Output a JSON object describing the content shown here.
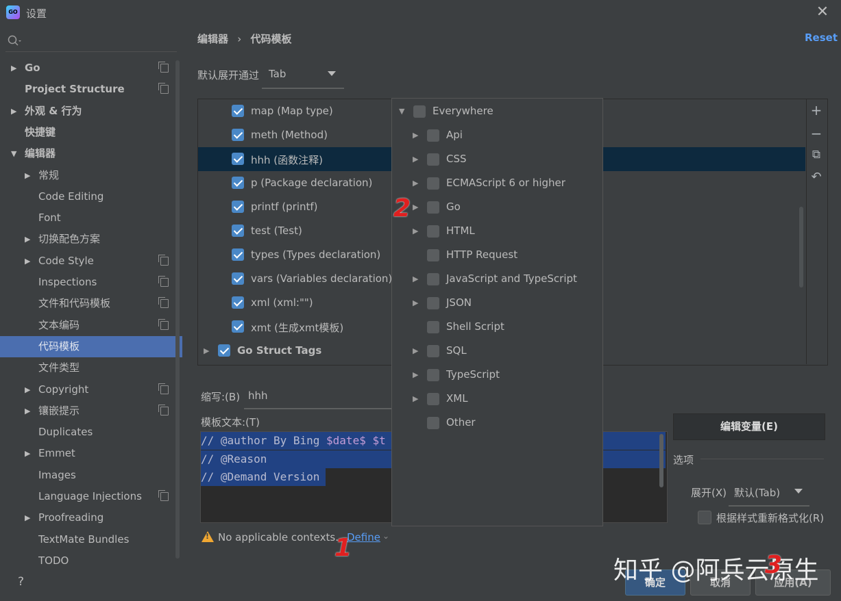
{
  "window": {
    "title": "设置",
    "logo_text": "GO"
  },
  "sidebar": {
    "items": [
      {
        "label": "Go",
        "indent": 0,
        "arrow": "right",
        "bold": true,
        "copy": true
      },
      {
        "label": "Project Structure",
        "indent": 0,
        "arrow": null,
        "bold": true,
        "copy": true
      },
      {
        "label": "外观 & 行为",
        "indent": 0,
        "arrow": "right",
        "bold": true,
        "copy": false
      },
      {
        "label": "快捷键",
        "indent": 0,
        "arrow": null,
        "bold": true,
        "copy": false
      },
      {
        "label": "编辑器",
        "indent": 0,
        "arrow": "down",
        "bold": true,
        "copy": false
      },
      {
        "label": "常规",
        "indent": 1,
        "arrow": "right",
        "bold": false,
        "copy": false
      },
      {
        "label": "Code Editing",
        "indent": 2,
        "arrow": null,
        "bold": false,
        "copy": false
      },
      {
        "label": "Font",
        "indent": 2,
        "arrow": null,
        "bold": false,
        "copy": false
      },
      {
        "label": "切换配色方案",
        "indent": 1,
        "arrow": "right",
        "bold": false,
        "copy": false
      },
      {
        "label": "Code Style",
        "indent": 1,
        "arrow": "right",
        "bold": false,
        "copy": true
      },
      {
        "label": "Inspections",
        "indent": 2,
        "arrow": null,
        "bold": false,
        "copy": true
      },
      {
        "label": "文件和代码模板",
        "indent": 2,
        "arrow": null,
        "bold": false,
        "copy": true
      },
      {
        "label": "文本编码",
        "indent": 2,
        "arrow": null,
        "bold": false,
        "copy": true
      },
      {
        "label": "代码模板",
        "indent": 2,
        "arrow": null,
        "bold": false,
        "copy": false,
        "selected": true
      },
      {
        "label": "文件类型",
        "indent": 2,
        "arrow": null,
        "bold": false,
        "copy": false
      },
      {
        "label": "Copyright",
        "indent": 1,
        "arrow": "right",
        "bold": false,
        "copy": true
      },
      {
        "label": "镶嵌提示",
        "indent": 1,
        "arrow": "right",
        "bold": false,
        "copy": true
      },
      {
        "label": "Duplicates",
        "indent": 2,
        "arrow": null,
        "bold": false,
        "copy": false
      },
      {
        "label": "Emmet",
        "indent": 1,
        "arrow": "right",
        "bold": false,
        "copy": false
      },
      {
        "label": "Images",
        "indent": 2,
        "arrow": null,
        "bold": false,
        "copy": false
      },
      {
        "label": "Language Injections",
        "indent": 2,
        "arrow": null,
        "bold": false,
        "copy": true
      },
      {
        "label": "Proofreading",
        "indent": 1,
        "arrow": "right",
        "bold": false,
        "copy": false
      },
      {
        "label": "TextMate Bundles",
        "indent": 2,
        "arrow": null,
        "bold": false,
        "copy": false
      },
      {
        "label": "TODO",
        "indent": 2,
        "arrow": null,
        "bold": false,
        "copy": false
      }
    ]
  },
  "header": {
    "breadcrumb_parent": "编辑器",
    "breadcrumb_sep": "›",
    "breadcrumb_current": "代码模板",
    "reset": "Reset"
  },
  "expand_by": {
    "label": "默认展开通过",
    "value": "Tab"
  },
  "templates": [
    {
      "text": "map (Map type)"
    },
    {
      "text": "meth (Method)"
    },
    {
      "text": "hhh (函数注释)",
      "selected": true
    },
    {
      "text": "p (Package declaration)"
    },
    {
      "text": "printf (printf)"
    },
    {
      "text": "test (Test)"
    },
    {
      "text": "types (Types declaration)"
    },
    {
      "text": "vars (Variables declaration)"
    },
    {
      "text": "xml (xml:\"\")"
    },
    {
      "text": "xmt (生成xmt模板)"
    },
    {
      "text": "Go Struct Tags",
      "group": true
    }
  ],
  "toolbar": {
    "add": "+",
    "remove": "−",
    "copy": "⧉",
    "revert": "↶"
  },
  "abbreviation": {
    "label": "缩写:(B)",
    "value": "hhh"
  },
  "template_text": {
    "label": "模板文本:(T)",
    "lines": [
      [
        {
          "t": "// @author By Bing ",
          "c": "#b9bcd1"
        },
        {
          "t": "$date$ $t",
          "c": "#c49cd6"
        }
      ],
      [
        {
          "t": "// @Reason",
          "c": "#b9bcd1"
        }
      ],
      [
        {
          "t": "// @Demand Version",
          "c": "#b9bcd1"
        }
      ]
    ]
  },
  "edit_vars": "编辑变量(E)",
  "options": {
    "label": "选项",
    "expand_label": "展开(X)",
    "expand_value": "默认(Tab)",
    "reformat_label": "根据样式重新格式化(R)"
  },
  "warning": {
    "text": "No applicable contexts.",
    "define": "Define",
    "chevron": "⌄"
  },
  "contexts": [
    {
      "label": "Everywhere",
      "level": 0,
      "arrow": "down"
    },
    {
      "label": "Api",
      "level": 1,
      "arrow": "right"
    },
    {
      "label": "CSS",
      "level": 1,
      "arrow": "right"
    },
    {
      "label": "ECMAScript 6 or higher",
      "level": 1,
      "arrow": "right"
    },
    {
      "label": "Go",
      "level": 1,
      "arrow": "right"
    },
    {
      "label": "HTML",
      "level": 1,
      "arrow": "right"
    },
    {
      "label": "HTTP Request",
      "level": 1,
      "arrow": null
    },
    {
      "label": "JavaScript and TypeScript",
      "level": 1,
      "arrow": "right"
    },
    {
      "label": "JSON",
      "level": 1,
      "arrow": "right"
    },
    {
      "label": "Shell Script",
      "level": 1,
      "arrow": null
    },
    {
      "label": "SQL",
      "level": 1,
      "arrow": "right"
    },
    {
      "label": "TypeScript",
      "level": 1,
      "arrow": "right"
    },
    {
      "label": "XML",
      "level": 1,
      "arrow": "right"
    },
    {
      "label": "Other",
      "level": 1,
      "arrow": null
    }
  ],
  "buttons": {
    "help": "?",
    "ok": "确定",
    "cancel": "取消",
    "apply": "应用(A)"
  },
  "annotations": [
    "1",
    "2",
    "3"
  ],
  "watermark": "知乎 @阿兵云原生",
  "colors": {
    "accent": "#4b6eaf",
    "link": "#589df6",
    "checkbox": "#4a88c7",
    "annotation": "#e02020"
  }
}
